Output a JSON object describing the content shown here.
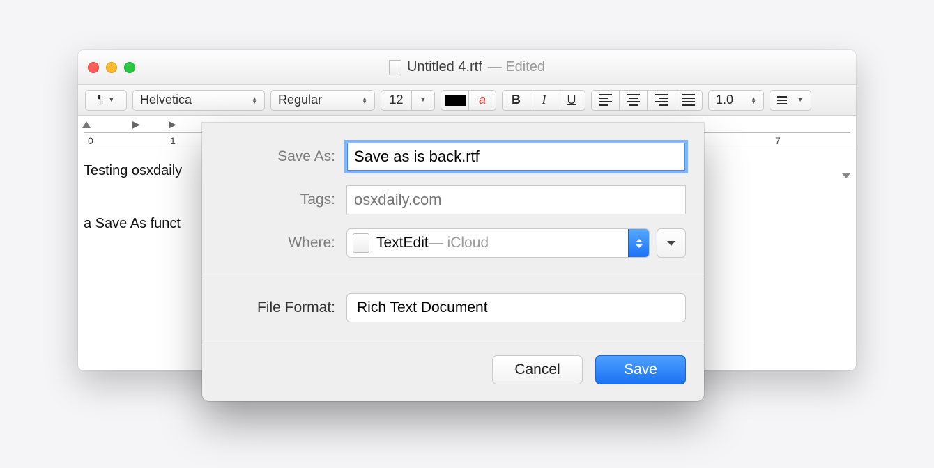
{
  "window": {
    "filename": "Untitled 4.rtf",
    "status": "— Edited"
  },
  "toolbar": {
    "para_symbol": "¶",
    "font_family": "Helvetica",
    "font_style": "Regular",
    "font_size": "12",
    "strike_sample": "a",
    "bold": "B",
    "italic": "I",
    "underline": "U",
    "line_spacing": "1.0"
  },
  "ruler": {
    "n0": "0",
    "n1": "1",
    "n7": "7"
  },
  "document": {
    "line1": "Testing osxdaily",
    "line2": "a Save As funct"
  },
  "sheet": {
    "save_as_label": "Save As:",
    "save_as_value": "Save as is back.rtf",
    "tags_label": "Tags:",
    "tags_placeholder": "osxdaily.com",
    "where_label": "Where:",
    "where_app": "TextEdit",
    "where_cloud": " — iCloud",
    "format_label": "File Format:",
    "format_value": "Rich Text Document",
    "cancel": "Cancel",
    "save": "Save"
  }
}
